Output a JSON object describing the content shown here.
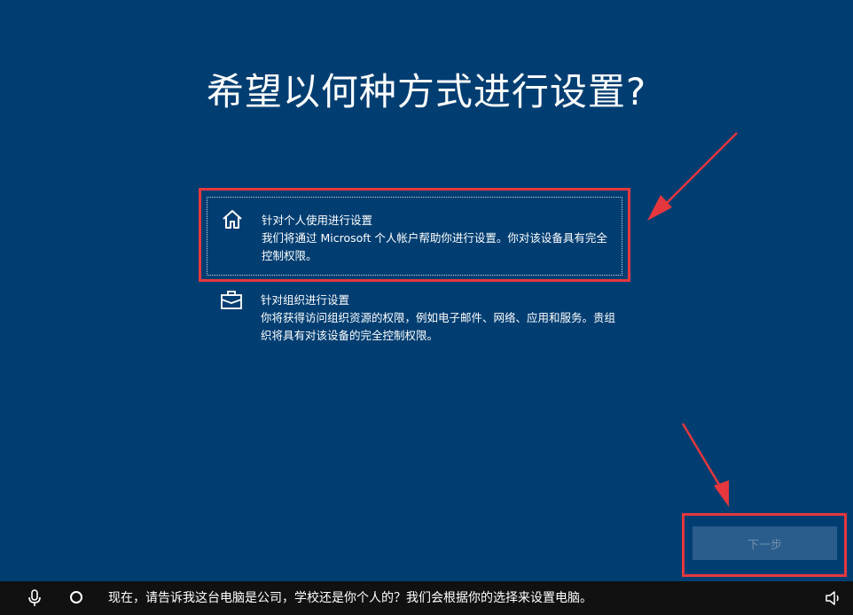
{
  "page": {
    "title": "希望以何种方式进行设置?"
  },
  "options": [
    {
      "icon": "home-icon",
      "title": "针对个人使用进行设置",
      "description": "我们将通过 Microsoft 个人帐户帮助你进行设置。你对该设备具有完全控制权限。",
      "selected": true
    },
    {
      "icon": "briefcase-icon",
      "title": "针对组织进行设置",
      "description": "你将获得访问组织资源的权限，例如电子邮件、网络、应用和服务。贵组织将具有对该设备的完全控制权限。",
      "selected": false
    }
  ],
  "actions": {
    "next_label": "下一步"
  },
  "taskbar": {
    "mic_icon": "microphone-icon",
    "cortana_icon": "cortana-circle-icon",
    "message": "现在，请告诉我这台电脑是公司，学校还是你个人的？我们会根据你的选择来设置电脑。",
    "volume_icon": "speaker-icon"
  },
  "colors": {
    "background": "#003e72",
    "annotation_red": "#e5373d",
    "button_disabled_bg": "#2a5d8c",
    "taskbar_bg": "#111111"
  }
}
